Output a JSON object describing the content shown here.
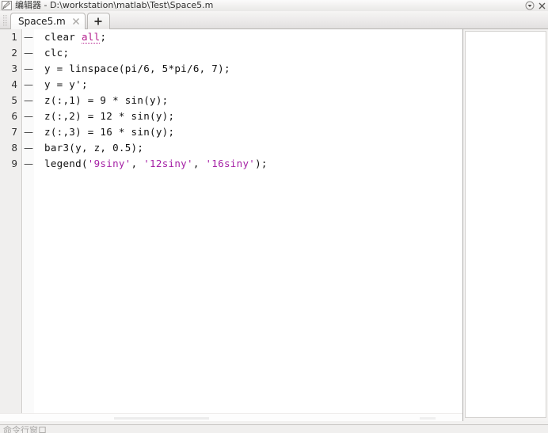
{
  "window": {
    "title": "编辑器 - D:\\workstation\\matlab\\Test\\Space5.m",
    "icon": "editor-pencil-icon",
    "minimize_icon": "chevron-down-circle-icon",
    "close_icon": "close-icon"
  },
  "tabs": {
    "grip": "drag-grip-icon",
    "items": [
      {
        "label": "Space5.m",
        "close": "×",
        "active": true
      }
    ],
    "new_tab_label": "+"
  },
  "editor": {
    "lines": [
      {
        "number": "1",
        "marker": "—",
        "segments": [
          {
            "text": "clear ",
            "type": "plain"
          },
          {
            "text": "all",
            "type": "warn"
          },
          {
            "text": ";",
            "type": "plain"
          }
        ]
      },
      {
        "number": "2",
        "marker": "—",
        "segments": [
          {
            "text": "clc;",
            "type": "plain"
          }
        ]
      },
      {
        "number": "3",
        "marker": "—",
        "segments": [
          {
            "text": "y = linspace(pi/6, 5*pi/6, 7);",
            "type": "plain"
          }
        ]
      },
      {
        "number": "4",
        "marker": "—",
        "segments": [
          {
            "text": "y = y';",
            "type": "plain"
          }
        ]
      },
      {
        "number": "5",
        "marker": "—",
        "segments": [
          {
            "text": "z(:,1) = 9 * sin(y);",
            "type": "plain"
          }
        ]
      },
      {
        "number": "6",
        "marker": "—",
        "segments": [
          {
            "text": "z(:,2) = 12 * sin(y);",
            "type": "plain"
          }
        ]
      },
      {
        "number": "7",
        "marker": "—",
        "segments": [
          {
            "text": "z(:,3) = 16 * sin(y);",
            "type": "plain"
          }
        ]
      },
      {
        "number": "8",
        "marker": "—",
        "segments": [
          {
            "text": "bar3(y, z, 0.5);",
            "type": "plain"
          }
        ]
      },
      {
        "number": "9",
        "marker": "—",
        "segments": [
          {
            "text": "legend(",
            "type": "plain"
          },
          {
            "text": "'9siny'",
            "type": "string"
          },
          {
            "text": ", ",
            "type": "plain"
          },
          {
            "text": "'12siny'",
            "type": "string"
          },
          {
            "text": ", ",
            "type": "plain"
          },
          {
            "text": "'16siny'",
            "type": "string"
          },
          {
            "text": ");",
            "type": "plain"
          }
        ]
      }
    ]
  },
  "statusbar": {
    "text": "命令行窗口"
  },
  "colors": {
    "warn": "#b41e8e",
    "string": "#a520a5",
    "code": "#111111",
    "gutter_bg": "#f0efee",
    "editor_bg": "#ffffff",
    "chrome_bg": "#f2f1f0"
  }
}
